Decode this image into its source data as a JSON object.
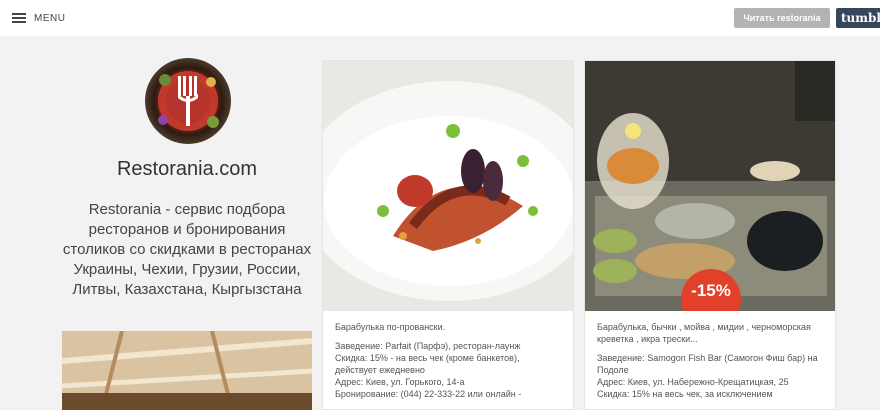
{
  "header": {
    "menu_label": "MENU",
    "follow_button": "Читать restorania",
    "tumblr_label": "tumblr"
  },
  "sidebar": {
    "title": "Restorania.com",
    "description": "Restorania - сервис подбора ресторанов и бронирования столиков со скидками в ресторанах Украины, Чехии, Грузии, России, Литвы, Казахстана, Кыргызстана"
  },
  "posts": [
    {
      "caption": "Барабулька по-провански.",
      "lines": [
        "Заведение: Parfait (Парфэ), ресторан-лаунж",
        "Скидка: 15% - на весь чек (кроме банкетов), действует ежедневно",
        "Адрес: Киев, ул. Горького, 14-а",
        "Бронирование: (044) 22-333-22 или онлайн -"
      ]
    },
    {
      "caption": "Барабулька, бычки , мойва , мидии , черноморская креветка , икра трески...",
      "badge": "-15%",
      "lines": [
        "Заведение: Samogon Fish Bar (Самогон Фиш бар) на Подоле",
        "Адрес: Киев, ул. Набережно-Крещатицкая, 25",
        "Скидка: 15% на весь чек, за исключением"
      ]
    }
  ],
  "colors": {
    "background": "#f2f2f2",
    "follow_button": "#b3b3b3",
    "tumblr": "#35465c",
    "discount_badge": "#e2402a"
  }
}
